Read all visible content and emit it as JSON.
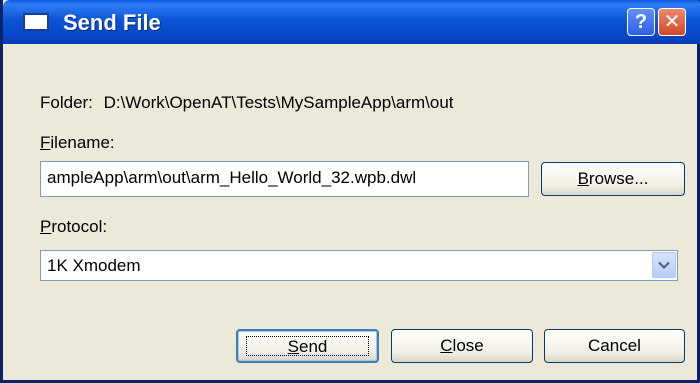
{
  "window": {
    "title": "Send File",
    "help_glyph": "?",
    "close_glyph": "✕"
  },
  "folder": {
    "label": "Folder:",
    "path": "D:\\Work\\OpenAT\\Tests\\MySampleApp\\arm\\out"
  },
  "filename": {
    "label_mnemonic": "F",
    "label_rest": "ilename:",
    "value": "ampleApp\\arm\\out\\arm_Hello_World_32.wpb.dwl"
  },
  "browse": {
    "mnemonic": "B",
    "rest": "rowse..."
  },
  "protocol": {
    "label_mnemonic": "P",
    "label_rest": "rotocol:",
    "selected": "1K Xmodem"
  },
  "buttons": {
    "send": {
      "mnemonic": "S",
      "rest": "end"
    },
    "close": {
      "mnemonic": "C",
      "rest": "lose"
    },
    "cancel": {
      "label": "Cancel"
    }
  },
  "icons": [
    "window-icon",
    "help-icon",
    "close-icon",
    "dropdown-arrow-icon"
  ]
}
